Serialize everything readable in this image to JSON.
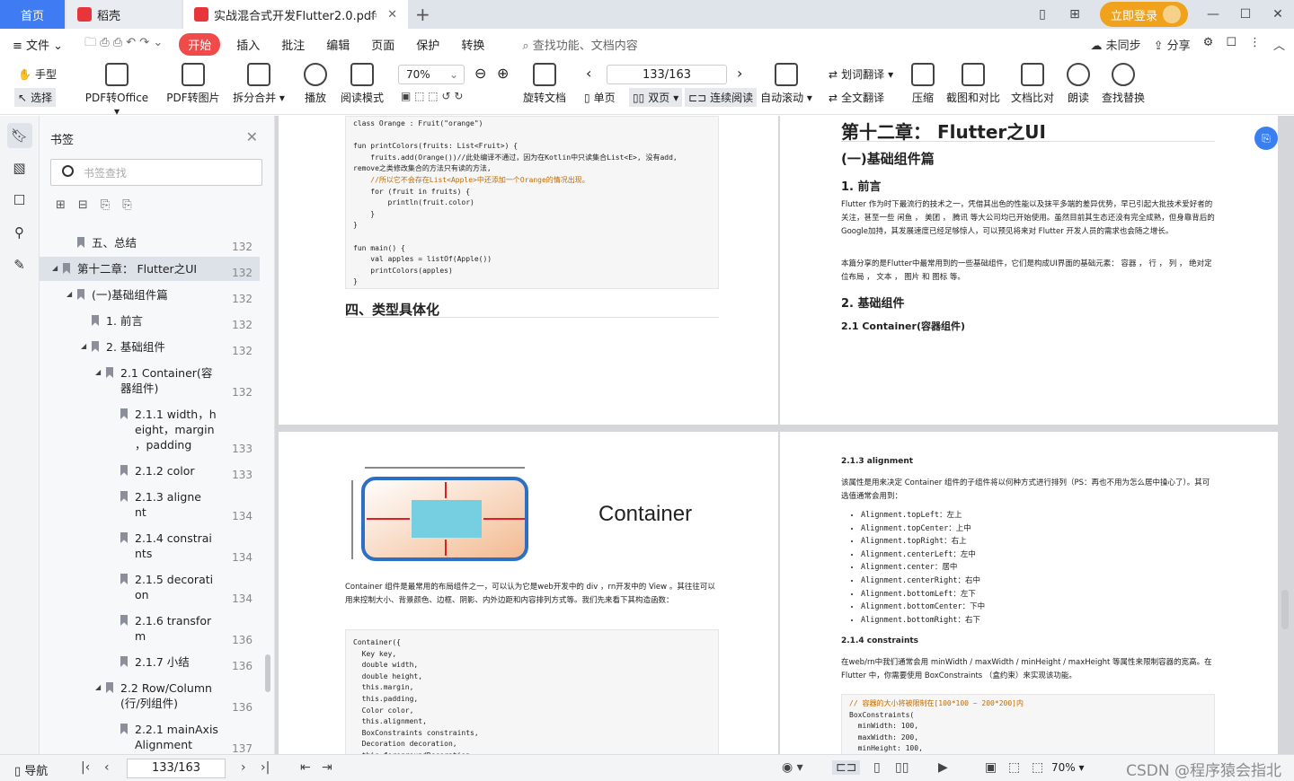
{
  "tabs": {
    "home": "首页",
    "daoke": "稻壳",
    "pdf": "实战混合式开发Flutter2.0.pdf"
  },
  "titlebar": {
    "login": "立即登录"
  },
  "menu": {
    "file": "文件",
    "items": [
      "开始",
      "插入",
      "批注",
      "编辑",
      "页面",
      "保护",
      "转换"
    ],
    "search": "查找功能、文档内容",
    "unsync": "未同步",
    "share": "分享"
  },
  "ribbon": {
    "hand": "手型",
    "select": "选择",
    "pdf_to_office": "PDF转Office",
    "pdf_to_image": "PDF转图片",
    "split_merge": "拆分合并",
    "play": "播放",
    "read_mode": "阅读模式",
    "zoom": "70%",
    "rotate": "旋转文档",
    "page_value": "133/163",
    "single": "单页",
    "double": "双页",
    "continuous": "连续阅读",
    "auto_scroll": "自动滚动",
    "word_translate": "划词翻译",
    "full_translate": "全文翻译",
    "compress": "压缩",
    "screenshot_compare": "截图和对比",
    "doc_compare": "文档比对",
    "read_aloud": "朗读",
    "find_replace": "查找替换"
  },
  "bookmarks": {
    "title": "书签",
    "search_placeholder": "书签查找",
    "items": [
      {
        "label": "五、总结",
        "page": "132"
      },
      {
        "label": "第十二章： Flutter之UI",
        "page": "132"
      },
      {
        "label": "(一)基础组件篇",
        "page": "132"
      },
      {
        "label": "1. 前言",
        "page": "132"
      },
      {
        "label": "2. 基础组件",
        "page": "132"
      },
      {
        "label": "2.1 Container(容\n器组件)",
        "page": "132"
      },
      {
        "label": "2.1.1 width，h\neight，margin\n，padding",
        "page": "133"
      },
      {
        "label": "2.1.2 color",
        "page": "133"
      },
      {
        "label": "2.1.3 aligne\nnt",
        "page": "134"
      },
      {
        "label": "2.1.4 constrai\nnts",
        "page": "134"
      },
      {
        "label": "2.1.5 decorati\non",
        "page": "134"
      },
      {
        "label": "2.1.6 transfor\nm",
        "page": "136"
      },
      {
        "label": "2.1.7 小结",
        "page": "136"
      },
      {
        "label": "2.2 Row/Column\n(行/列组件)",
        "page": "136"
      },
      {
        "label": "2.2.1 mainAxis\nAlignment",
        "page": "137"
      }
    ]
  },
  "pages": {
    "p1": {
      "code_lines": [
        "class Orange : Fruit(\"orange\")",
        "",
        "fun printColors(fruits: List<Fruit>) {",
        "    fruits.add(Orange())//此处编译不通过，因为在Kotlin中只读集合List<E>, 没有add,",
        "remove之类修改集合的方法只有读的方法,",
        "    //所以它不会存在List<Apple>中还添加一个Orange的情况出现。",
        "    for (fruit in fruits) {",
        "        println(fruit.color)",
        "    }",
        "}",
        "",
        "fun main() {",
        "    val apples = listOf(Apple())",
        "    printColors(apples)",
        "}"
      ],
      "heading": "四、类型具体化"
    },
    "p2": {
      "chapter": "第十二章： Flutter之UI",
      "section": "(一)基础组件篇",
      "h_intro": "1. 前言",
      "intro_1": "Flutter 作为时下最流行的技术之一，凭借其出色的性能以及抹平多端的差异优势，早已引起大批技术爱好者的关注，甚至一些 闲鱼 ， 美团 ， 腾讯 等大公司均已开始使用。虽然目前其生态还没有完全成熟，但身靠背后的Google加持，其发展速度已经足够惊人，可以预见将来对 Flutter 开发人员的需求也会随之增长。",
      "intro_2": "本篇分享的是Flutter中最常用到的一些基础组件，它们是构成UI界面的基础元素： 容器 ， 行 ， 列 ， 绝对定位布局 ， 文本 ， 图片 和 图标 等。",
      "h_basic": "2. 基础组件",
      "h_container": "2.1 Container(容器组件)"
    },
    "p3": {
      "diagram_label": "Container",
      "desc": "Container 组件是最常用的布局组件之一，可以认为它是web开发中的 div ，rn开发中的 View 。其往往可以用来控制大小、背景颜色、边框、阴影、内外边距和内容排列方式等。我们先来看下其构造函数：",
      "code_lines": [
        "Container({",
        "  Key key,",
        "  double width,",
        "  double height,",
        "  this.margin,",
        "  this.padding,",
        "  Color color,",
        "  this.alignment,",
        "  BoxConstraints constraints,",
        "  Decoration decoration,",
        "  this.foregroundDecoration,"
      ]
    },
    "p4": {
      "h_align": "2.1.3 alignment",
      "align_desc": "该属性是用来决定 Container 组件的子组件将以何种方式进行排列（PS：再也不用为怎么居中操心了）。其可选值通常会用到：",
      "align_items": [
        "Alignment.topLeft：左上",
        "Alignment.topCenter：上中",
        "Alignment.topRight：右上",
        "Alignment.centerLeft：左中",
        "Alignment.center：居中",
        "Alignment.centerRight：右中",
        "Alignment.bottomLeft：左下",
        "Alignment.bottomCenter：下中",
        "Alignment.bottomRight：右下"
      ],
      "h_constraints": "2.1.4 constraints",
      "constraints_desc": "在web/rn中我们通常会用 minWidth / maxWidth / minHeight / maxHeight 等属性来限制容器的宽高。在 Flutter 中，你需要使用 BoxConstraints （盒约束）来实现该功能。",
      "code_lines": [
        "// 容器的大小将被限制在[100*100 ~ 200*200]内",
        "BoxConstraints(",
        "  minWidth: 100,",
        "  maxWidth: 200,",
        "  minHeight: 100,"
      ]
    }
  },
  "status": {
    "nav": "导航",
    "page": "133/163",
    "zoom": "70%",
    "watermark": "CSDN @程序猿会指北"
  }
}
